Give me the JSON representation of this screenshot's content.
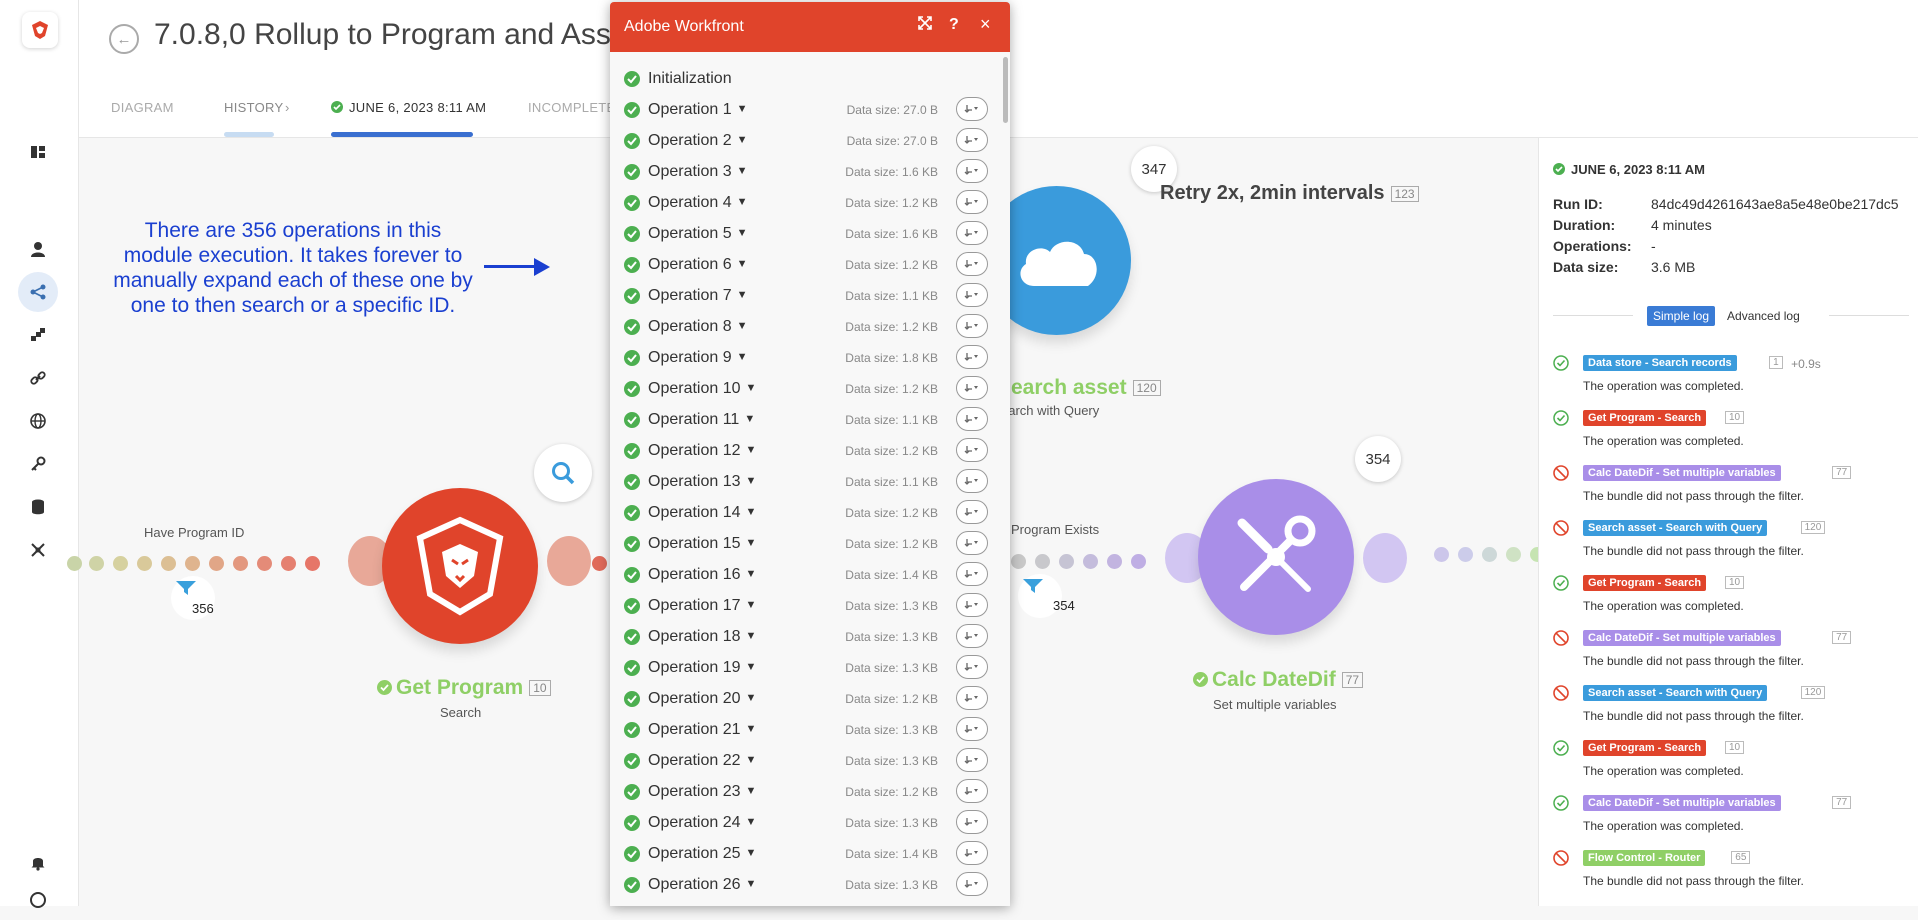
{
  "header": {
    "title": "7.0.8,0 Rollup to Program and Asset",
    "tabs": [
      "DIAGRAM",
      "HISTORY",
      "JUNE 6, 2023 8:11 AM",
      "INCOMPLETE"
    ]
  },
  "annotation": "There are 356 operations in this module execution.  It takes forever to manually expand each of these one by one to then search or a specific ID.",
  "scenario": {
    "top_label": "Retry 2x, 2min intervals",
    "top_label_id": "123",
    "top_bubble": "347",
    "route_left_label": "Have Program ID",
    "route_right_label": "Program Exists",
    "filter_left": "356",
    "filter_right": "354",
    "bubble_right": "354",
    "modules": [
      {
        "name": "Get Program",
        "id": "10",
        "sub": "Search",
        "color": "#e0442b"
      },
      {
        "name": "earch asset",
        "id": "120",
        "sub": "earch with Query",
        "color": "#3a9bdc"
      },
      {
        "name": "Calc DateDif",
        "id": "77",
        "sub": "Set multiple variables",
        "color": "#a98ee8"
      }
    ]
  },
  "dialog": {
    "title": "Adobe Workfront",
    "first": "Initialization",
    "operations": [
      {
        "label": "Operation 1",
        "size": "Data size: 27.0 B"
      },
      {
        "label": "Operation 2",
        "size": "Data size: 27.0 B"
      },
      {
        "label": "Operation 3",
        "size": "Data size: 1.6 KB"
      },
      {
        "label": "Operation 4",
        "size": "Data size: 1.2 KB"
      },
      {
        "label": "Operation 5",
        "size": "Data size: 1.6 KB"
      },
      {
        "label": "Operation 6",
        "size": "Data size: 1.2 KB"
      },
      {
        "label": "Operation 7",
        "size": "Data size: 1.1 KB"
      },
      {
        "label": "Operation 8",
        "size": "Data size: 1.2 KB"
      },
      {
        "label": "Operation 9",
        "size": "Data size: 1.8 KB"
      },
      {
        "label": "Operation 10",
        "size": "Data size: 1.2 KB"
      },
      {
        "label": "Operation 11",
        "size": "Data size: 1.1 KB"
      },
      {
        "label": "Operation 12",
        "size": "Data size: 1.2 KB"
      },
      {
        "label": "Operation 13",
        "size": "Data size: 1.1 KB"
      },
      {
        "label": "Operation 14",
        "size": "Data size: 1.2 KB"
      },
      {
        "label": "Operation 15",
        "size": "Data size: 1.2 KB"
      },
      {
        "label": "Operation 16",
        "size": "Data size: 1.4 KB"
      },
      {
        "label": "Operation 17",
        "size": "Data size: 1.3 KB"
      },
      {
        "label": "Operation 18",
        "size": "Data size: 1.3 KB"
      },
      {
        "label": "Operation 19",
        "size": "Data size: 1.3 KB"
      },
      {
        "label": "Operation 20",
        "size": "Data size: 1.2 KB"
      },
      {
        "label": "Operation 21",
        "size": "Data size: 1.3 KB"
      },
      {
        "label": "Operation 22",
        "size": "Data size: 1.3 KB"
      },
      {
        "label": "Operation 23",
        "size": "Data size: 1.2 KB"
      },
      {
        "label": "Operation 24",
        "size": "Data size: 1.3 KB"
      },
      {
        "label": "Operation 25",
        "size": "Data size: 1.4 KB"
      },
      {
        "label": "Operation 26",
        "size": "Data size: 1.3 KB"
      }
    ]
  },
  "run": {
    "date": "JUNE 6, 2023 8:11 AM",
    "fields": [
      {
        "key": "Run ID:",
        "value": "84dc49d4261643ae8a5e48e0be217dc5"
      },
      {
        "key": "Duration:",
        "value": "4 minutes"
      },
      {
        "key": "Operations:",
        "value": "-"
      },
      {
        "key": "Data size:",
        "value": "3.6 MB"
      }
    ],
    "log_tabs": [
      "Simple log",
      "Advanced log"
    ],
    "log": [
      {
        "status": "ok",
        "badge": "Data store - Search records",
        "color": "#3a9bdc",
        "num": "1",
        "time": "+0.9s",
        "msg": "The operation was completed."
      },
      {
        "status": "ok",
        "badge": "Get Program - Search",
        "color": "#e0442b",
        "num": "10",
        "msg": "The operation was completed."
      },
      {
        "status": "blocked",
        "badge": "Calc DateDif - Set multiple variables",
        "color": "#a98ee8",
        "num": "77",
        "msg": "The bundle did not pass through the filter."
      },
      {
        "status": "blocked",
        "badge": "Search asset - Search with Query",
        "color": "#3a9bdc",
        "num": "120",
        "msg": "The bundle did not pass through the filter."
      },
      {
        "status": "ok",
        "badge": "Get Program - Search",
        "color": "#e0442b",
        "num": "10",
        "msg": "The operation was completed."
      },
      {
        "status": "blocked",
        "badge": "Calc DateDif - Set multiple variables",
        "color": "#a98ee8",
        "num": "77",
        "msg": "The bundle did not pass through the filter."
      },
      {
        "status": "blocked",
        "badge": "Search asset - Search with Query",
        "color": "#3a9bdc",
        "num": "120",
        "msg": "The bundle did not pass through the filter."
      },
      {
        "status": "ok",
        "badge": "Get Program - Search",
        "color": "#e0442b",
        "num": "10",
        "msg": "The operation was completed."
      },
      {
        "status": "ok",
        "badge": "Calc DateDif - Set multiple variables",
        "color": "#a98ee8",
        "num": "77",
        "msg": "The operation was completed."
      },
      {
        "status": "blocked",
        "badge": "Flow Control - Router",
        "color": "#8fcf66",
        "num": "65",
        "msg": "The bundle did not pass through the filter."
      }
    ]
  }
}
